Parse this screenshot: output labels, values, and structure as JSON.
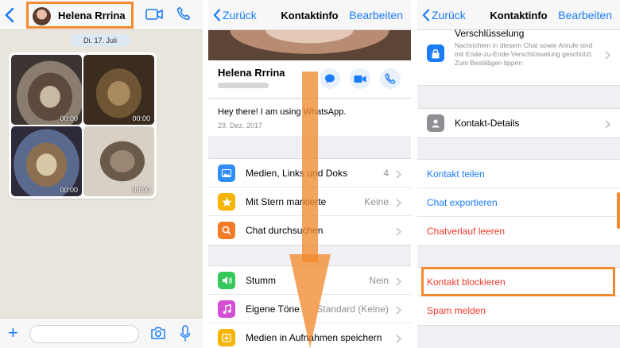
{
  "colors": {
    "accent": "#1a7cf7",
    "highlight": "#f28a30",
    "danger": "#f03a2e"
  },
  "panel1": {
    "contact_name": "Helena Rrrina",
    "date_label": "Di. 17. Juli",
    "videos": [
      {
        "duration": "00:00"
      },
      {
        "duration": "00:00"
      },
      {
        "duration": "00:00"
      },
      {
        "duration": "00:00"
      }
    ],
    "icons": [
      "back-icon",
      "video-call-icon",
      "phone-icon",
      "plus-icon",
      "camera-icon",
      "microphone-icon"
    ]
  },
  "panel2": {
    "back_label": "Zurück",
    "title": "Kontaktinfo",
    "edit_label": "Bearbeiten",
    "name": "Helena Rrrina",
    "status_text": "Hey there! I am using WhatsApp.",
    "status_date": "29. Dez. 2017",
    "group1": [
      {
        "label": "Medien, Links und Doks",
        "value": "4",
        "icon": "photos-icon",
        "color": "#2f8ff6"
      },
      {
        "label": "Mit Stern markierte",
        "value": "Keine",
        "icon": "star-icon",
        "color": "#f5b400"
      },
      {
        "label": "Chat durchsuchen",
        "value": "",
        "icon": "search-icon",
        "color": "#f47b25"
      }
    ],
    "group2": [
      {
        "label": "Stumm",
        "value": "Nein",
        "icon": "speaker-icon",
        "color": "#34c759"
      },
      {
        "label": "Eigene Töne",
        "value": "Standard (Keine)",
        "icon": "music-note-icon",
        "color": "#d44fd6"
      },
      {
        "label": "Medien in Aufnahmen speichern",
        "value": "",
        "icon": "save-media-icon",
        "color": "#f5b400"
      }
    ]
  },
  "panel3": {
    "back_label": "Zurück",
    "title": "Kontaktinfo",
    "edit_label": "Bearbeiten",
    "encryption_title": "Verschlüsselung",
    "encryption_text": "Nachrichten in diesem Chat sowie Anrufe sind mit Ende-zu-Ende-Verschlüsselung geschützt. Zum Bestätigen tippen",
    "details_label": "Kontakt-Details",
    "group_actions": [
      {
        "label": "Kontakt teilen"
      },
      {
        "label": "Chat exportieren"
      },
      {
        "label": "Chatverlauf leeren"
      }
    ],
    "block_label": "Kontakt blockieren",
    "spam_label": "Spam melden"
  }
}
